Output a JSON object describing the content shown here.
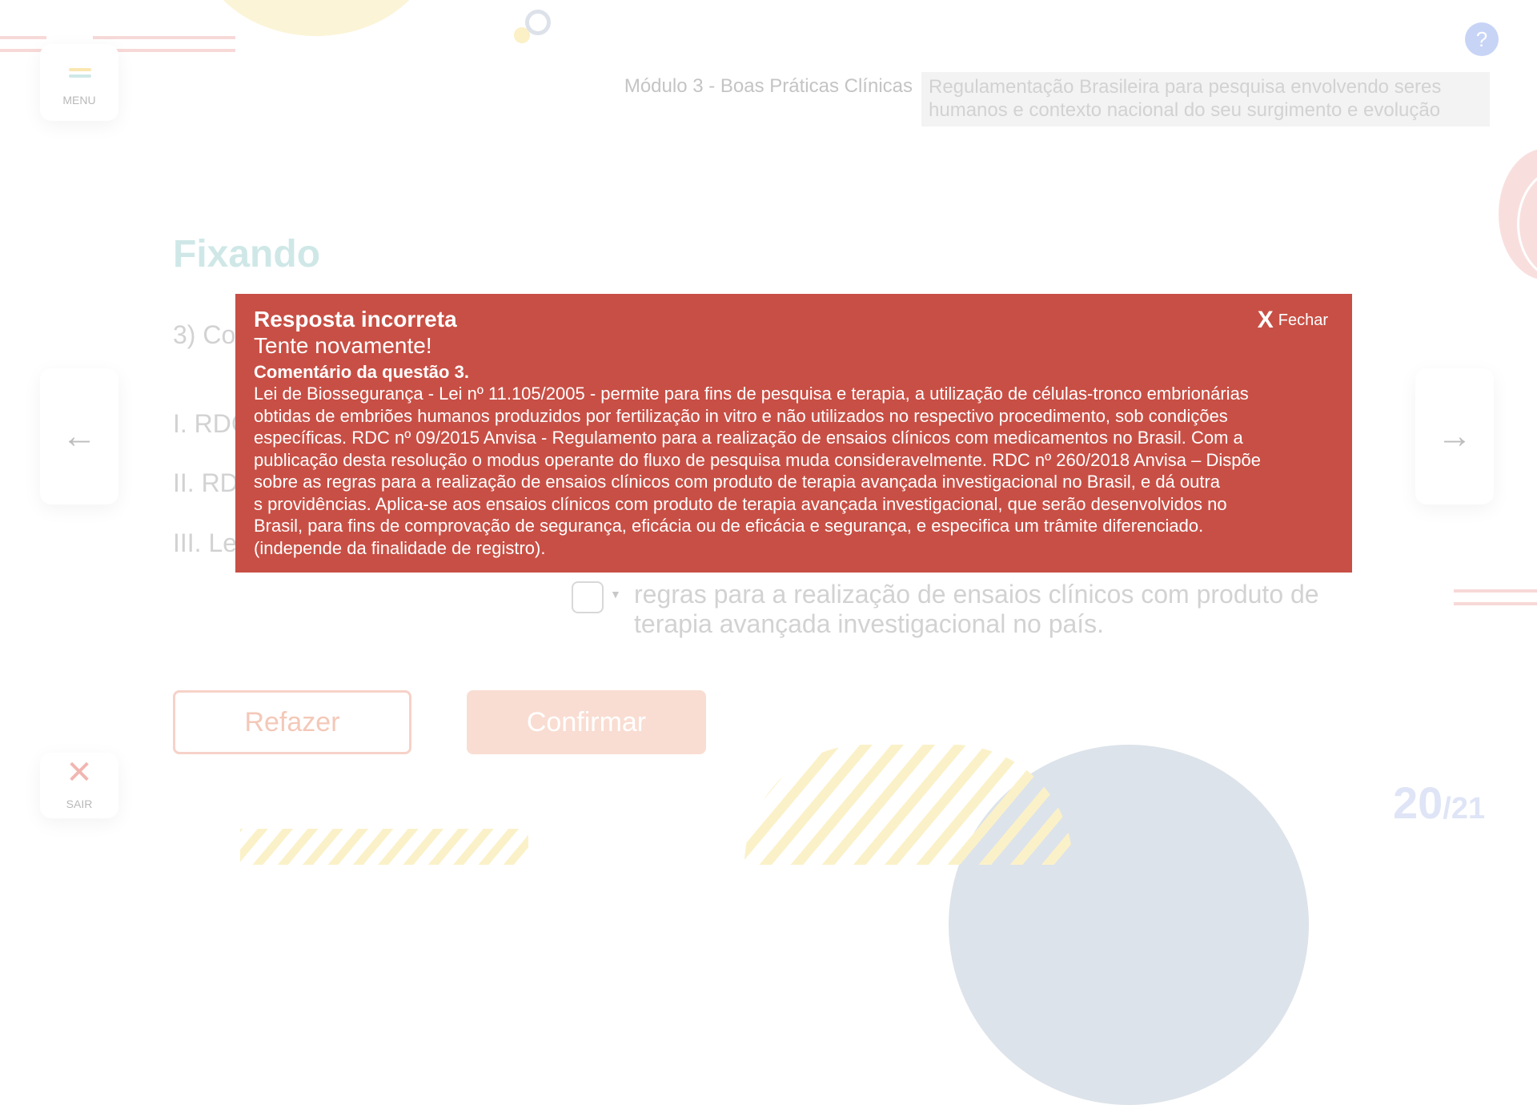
{
  "header": {
    "module": "Módulo 3 - Boas Práticas Clínicas",
    "subject_line1": "Regulamentação Brasileira para pesquisa envolvendo seres",
    "subject_line2": "humanos e contexto nacional do seu surgimento e evolução"
  },
  "nav": {
    "menu_label": "MENU",
    "exit_label": "SAIR",
    "exit_icon": "close-icon",
    "prev_icon": "arrow-left-icon",
    "next_icon": "arrow-right-icon",
    "help_icon": "question-icon",
    "help_glyph": "?"
  },
  "main": {
    "section_title": "Fixando",
    "question_start": "3) Co",
    "item_1": "I. RDC",
    "item_2": "II. RD",
    "item_3": "III. Le",
    "option_text_line1": "regras para a realização de ensaios clínicos com produto de",
    "option_text_line2": "terapia avançada investigacional no país.",
    "refazer_label": "Refazer",
    "confirmar_label": "Confirmar"
  },
  "pagination": {
    "current": "20",
    "total": "/21"
  },
  "modal": {
    "title": "Resposta incorreta",
    "subtitle": "Tente novamente!",
    "comment_title": "Comentário da questão 3.",
    "close_label": "Fechar",
    "close_glyph": "X",
    "body_lines": [
      "Lei de Biossegurança - Lei nº 11.105/2005 - permite para fins de pesquisa e terapia, a utilização de células-tronco embrionárias",
      "obtidas de embriões humanos produzidos por fertilização in vitro e não utilizados no respectivo procedimento, sob condições",
      "específicas. RDC nº 09/2015 Anvisa - Regulamento para a realização de ensaios clínicos com medicamentos no Brasil. Com a",
      "publicação desta resolução o modus operante do fluxo de pesquisa muda consideravelmente. RDC nº 260/2018 Anvisa – Dispõe",
      "sobre as regras para a realização de ensaios clínicos com produto de terapia avançada investigacional no Brasil, e dá outra",
      "s providências.  Aplica-se aos ensaios clínicos com produto de terapia avançada investigacional, que serão desenvolvidos no",
      " Brasil, para fins de comprovação de segurança, eficácia ou de eficácia e segurança, e especifica um trâmite diferenciado.",
      "(independe da finalidade de registro)."
    ]
  },
  "colors": {
    "modal_bg": "#c84f45",
    "accent_title": "#cfe8e7",
    "button_accent": "#f9ddd2"
  }
}
